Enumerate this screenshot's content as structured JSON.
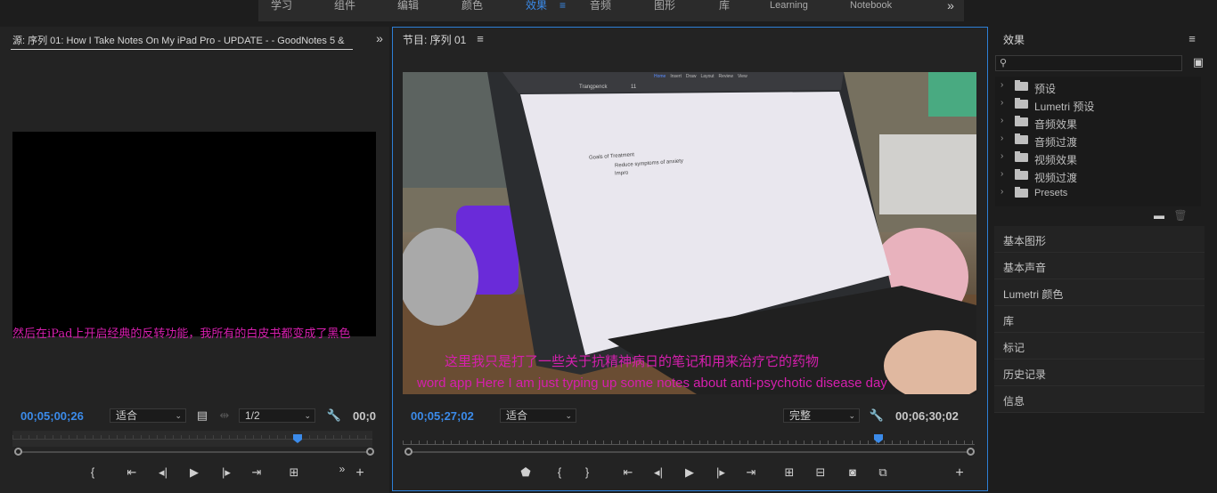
{
  "workspace": {
    "tabs": [
      {
        "label": "学习"
      },
      {
        "label": "组件"
      },
      {
        "label": "编辑"
      },
      {
        "label": "颜色"
      },
      {
        "label": "效果"
      },
      {
        "label": "音频"
      },
      {
        "label": "图形"
      },
      {
        "label": "库"
      },
      {
        "label": "Learning"
      },
      {
        "label": "Notebook"
      }
    ],
    "active_tab": "效果",
    "menu_icon": "hamburger-icon",
    "more_icon": "double-chevron-right-icon"
  },
  "source": {
    "title": "源: 序列 01: How I Take Notes On My iPad Pro  - UPDATE -  -  GoodNotes 5 &",
    "subtitle": "然后在iPad上开启经典的反转功能，我所有的白皮书都变成了黑色",
    "timecode": "00;05;00;26",
    "fit": "适合",
    "resolution": "1/2",
    "timecode_right": "00;0"
  },
  "program": {
    "title": "节目: 序列 01",
    "timecode": "00;05;27;02",
    "fit": "适合",
    "quality": "完整",
    "duration": "00;06;30;02",
    "subtitle_cn": "这里我只是打了一些关于抗精神病日的笔记和用来治疗它的药物",
    "subtitle_en": "word app Here I am just typing up some notes about anti-psychotic disease day",
    "note_lines": [
      "Goals of Treatment",
      "Reduce symptoms of anxiety",
      "Impro"
    ],
    "app_toolbar": [
      "Home",
      "Insert",
      "Draw",
      "Layout",
      "Review",
      "View"
    ],
    "font_name": "Trangpenck",
    "font_size": "11"
  },
  "effects": {
    "title": "效果",
    "items": [
      {
        "label": "预设"
      },
      {
        "label": "Lumetri 预设"
      },
      {
        "label": "音频效果"
      },
      {
        "label": "音频过渡"
      },
      {
        "label": "视频效果"
      },
      {
        "label": "视频过渡"
      },
      {
        "label": "Presets"
      }
    ],
    "panels": [
      {
        "label": "基本图形"
      },
      {
        "label": "基本声音"
      },
      {
        "label": "Lumetri 颜色"
      },
      {
        "label": "库"
      },
      {
        "label": "标记"
      },
      {
        "label": "历史记录"
      },
      {
        "label": "信息"
      }
    ]
  }
}
